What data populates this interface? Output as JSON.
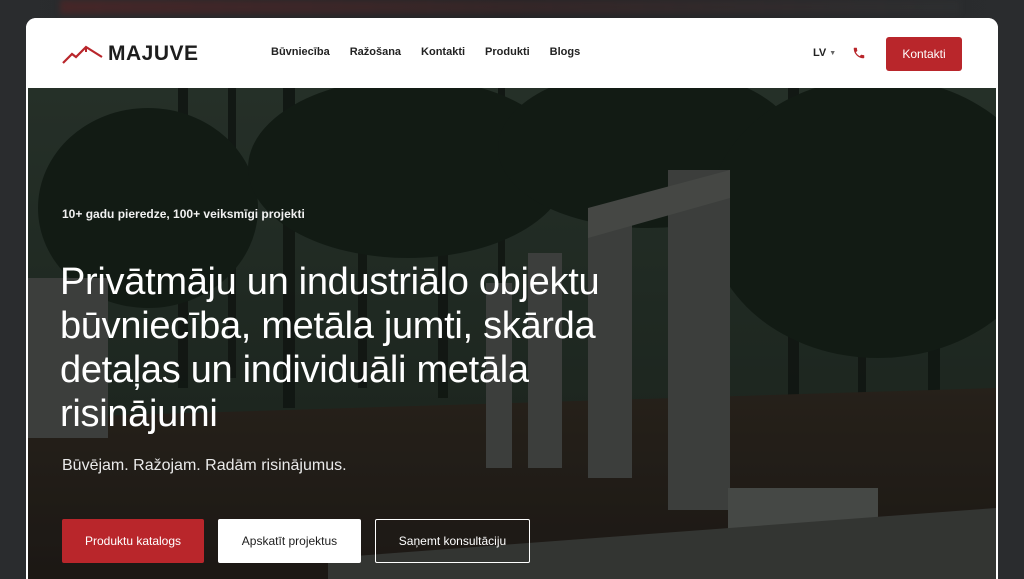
{
  "brand": {
    "name": "MAJUVE",
    "accent": "#b9262b"
  },
  "nav": {
    "items": [
      "Būvniecība",
      "Ražošana",
      "Kontakti",
      "Produkti",
      "Blogs"
    ]
  },
  "header": {
    "language": "LV",
    "phone_icon": "phone-icon",
    "cta_label": "Kontakti"
  },
  "hero": {
    "eyebrow": "10+ gadu pieredze, 100+ veiksmīgi projekti",
    "headline": "Privātmāju un industriālo objektu būvniecība, metāla jumti, skārda detaļas un individuāli metāla risinājumi",
    "subhead": "Būvējam. Ražojam. Radām risinājumus.",
    "buttons": {
      "catalog": "Produktu katalogs",
      "projects": "Apskatīt projektus",
      "consult": "Saņemt konsultāciju"
    }
  }
}
